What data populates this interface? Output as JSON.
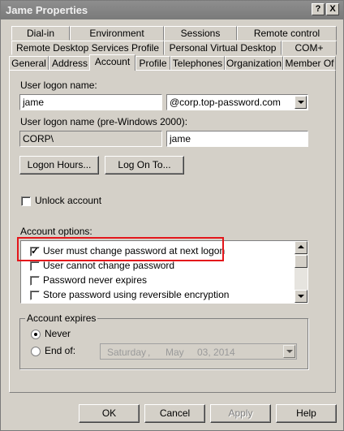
{
  "window": {
    "title": "Jame Properties",
    "help_button": "?",
    "close_button": "X"
  },
  "tabs": {
    "row1": [
      "Dial-in",
      "Environment",
      "Sessions",
      "Remote control"
    ],
    "row2": [
      "Remote Desktop Services Profile",
      "Personal Virtual Desktop",
      "COM+"
    ],
    "row3": [
      "General",
      "Address",
      "Account",
      "Profile",
      "Telephones",
      "Organization",
      "Member Of"
    ],
    "active": "Account"
  },
  "account": {
    "logon_name_label": "User logon name:",
    "logon_name_value": "jame",
    "domain_value": "@corp.top-password.com",
    "pre2000_label": "User logon name (pre-Windows 2000):",
    "pre2000_domain": "CORP\\",
    "pre2000_name": "jame",
    "logon_hours_button": "Logon Hours...",
    "logon_to_button": "Log On To...",
    "unlock_label": "Unlock account",
    "unlock_checked": false,
    "options_label": "Account options:",
    "options": [
      {
        "label": "User must change password at next logon",
        "checked": true
      },
      {
        "label": "User cannot change password",
        "checked": false
      },
      {
        "label": "Password never expires",
        "checked": false
      },
      {
        "label": "Store password using reversible encryption",
        "checked": false
      }
    ],
    "expires_legend": "Account expires",
    "never_label": "Never",
    "end_of_label": "End of:",
    "expires_selected": "Never",
    "date": {
      "weekday": "Saturday",
      "sep1": ",",
      "month": "May",
      "day_year": "03, 2014"
    }
  },
  "footer": {
    "ok": "OK",
    "cancel": "Cancel",
    "apply": "Apply",
    "help": "Help"
  },
  "colors": {
    "highlight_box": "#e4161b",
    "title_bar": "#7a7a7a",
    "face": "#d4d0c8"
  }
}
